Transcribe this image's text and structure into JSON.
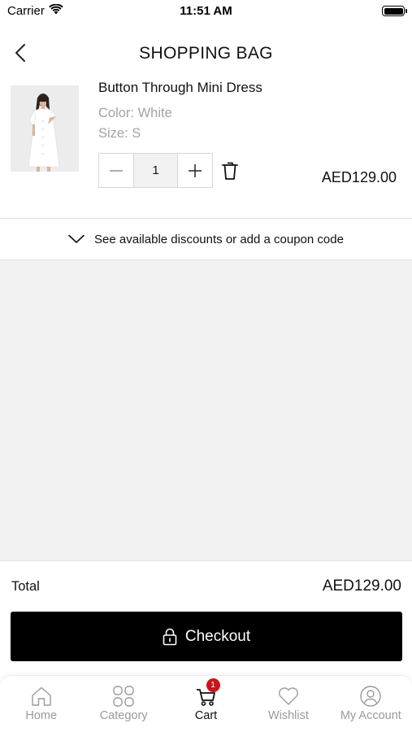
{
  "status_bar": {
    "carrier": "Carrier",
    "time": "11:51 AM",
    "wifi_icon": "wifi-icon",
    "battery_icon": "battery-icon"
  },
  "header": {
    "title": "SHOPPING BAG",
    "back_icon": "chevron-left-icon"
  },
  "cart_item": {
    "name": "Button Through Mini Dress",
    "color": "Color: White",
    "size": "Size: S",
    "quantity": "1",
    "price": "AED129.00",
    "image": "white-dress-product-image",
    "minus_icon": "minus-icon",
    "plus_icon": "plus-icon",
    "delete_icon": "trash-icon"
  },
  "coupon": {
    "label": "See available discounts or add a coupon code",
    "icon": "chevron-down-icon"
  },
  "summary": {
    "total_label": "Total",
    "total_value": "AED129.00"
  },
  "checkout": {
    "label": "Checkout",
    "icon": "lock-icon"
  },
  "tabbar": {
    "items": [
      {
        "label": "Home",
        "icon": "home-icon",
        "active": false
      },
      {
        "label": "Category",
        "icon": "grid-icon",
        "active": false
      },
      {
        "label": "Cart",
        "icon": "cart-icon",
        "active": true,
        "badge": "1"
      },
      {
        "label": "Wishlist",
        "icon": "heart-icon",
        "active": false
      },
      {
        "label": "My Account",
        "icon": "user-icon",
        "active": false
      }
    ]
  },
  "colors": {
    "accent": "#000000",
    "badge": "#c8161d",
    "muted_text": "#a3a3a3",
    "inactive_tab": "#9a9a9a",
    "background_grey": "#f2f2f2"
  }
}
